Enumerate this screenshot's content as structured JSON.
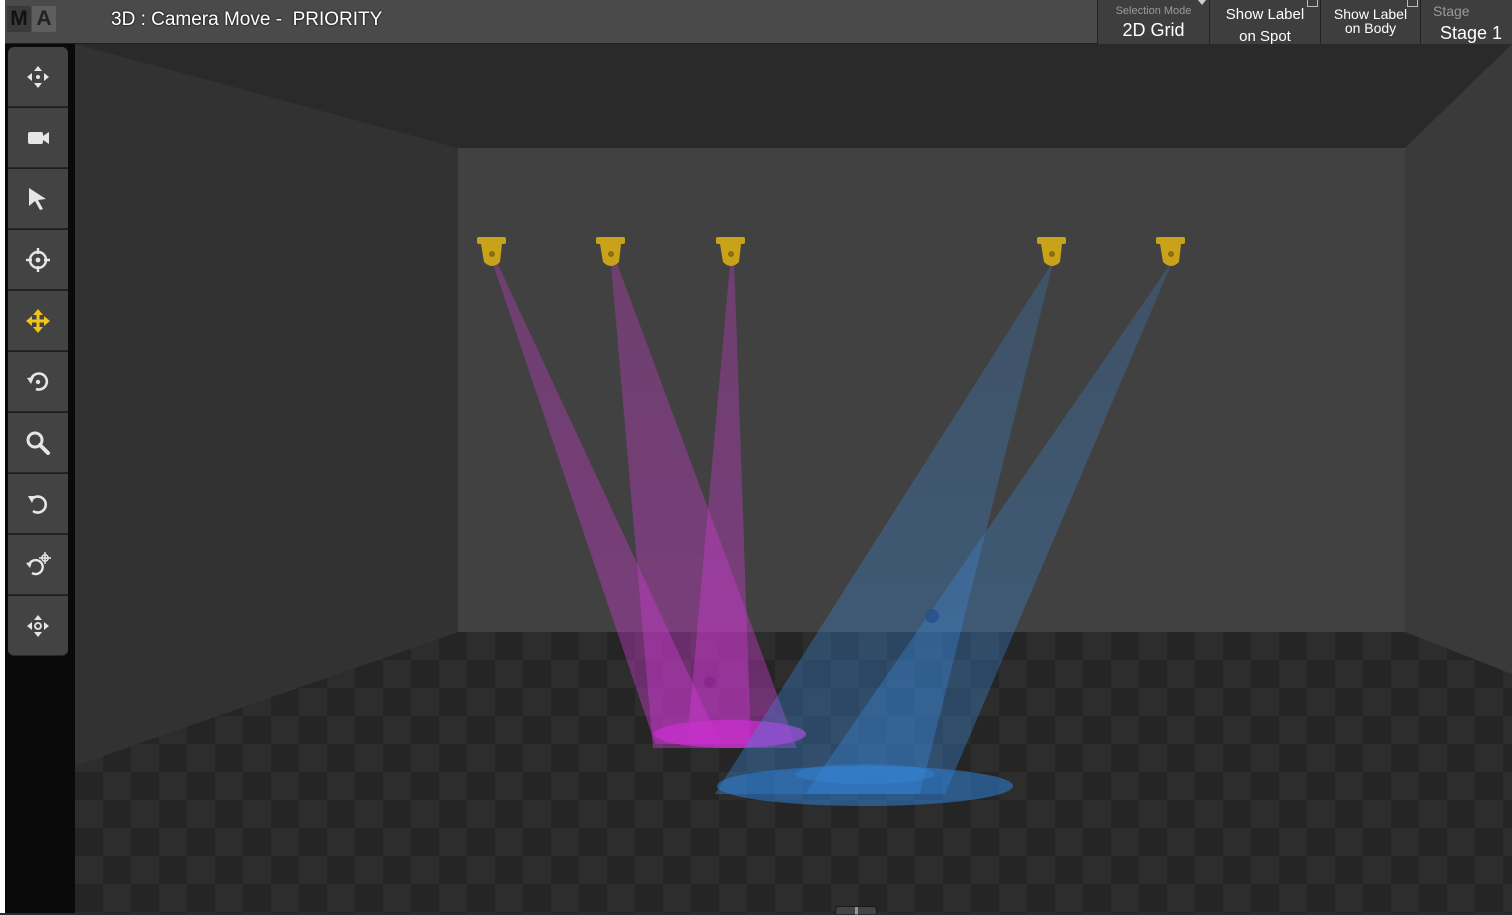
{
  "app": {
    "logo_letters": [
      "M",
      "A"
    ]
  },
  "window": {
    "title": "3D : Camera Move -  PRIORITY"
  },
  "header": {
    "selection_mode": {
      "label": "Selection Mode",
      "value": "2D Grid"
    },
    "show_label_spot": {
      "line1": "Show Label",
      "line2": "on Spot"
    },
    "show_label_body": {
      "line1": "Show Label",
      "line2": "on Body"
    },
    "stage": {
      "label": "Stage",
      "value": "Stage 1"
    }
  },
  "toolbar": {
    "tools": [
      {
        "name": "move-all-icon",
        "active": false
      },
      {
        "name": "camera-icon",
        "active": false
      },
      {
        "name": "select-arrow-icon",
        "active": false
      },
      {
        "name": "target-icon",
        "active": false
      },
      {
        "name": "camera-move-icon",
        "active": true
      },
      {
        "name": "rotate-icon",
        "active": false
      },
      {
        "name": "zoom-icon",
        "active": false
      },
      {
        "name": "orbit-icon",
        "active": false
      },
      {
        "name": "orbit-point-icon",
        "active": false
      },
      {
        "name": "pan-icon",
        "active": false
      }
    ]
  },
  "scene": {
    "fixture_color": "#c9a21a",
    "beam_colors": {
      "magenta": "#d23ad6",
      "blue": "#3a8ee6"
    },
    "fixture_count": 5
  },
  "colors": {
    "accent": "#f0c419",
    "panel": "#434343",
    "background": "#2b2b2b"
  }
}
